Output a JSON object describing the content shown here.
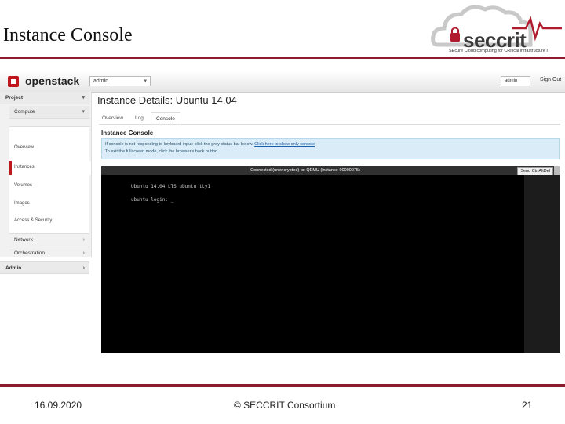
{
  "slide": {
    "title": "Instance Console",
    "footer_date": "16.09.2020",
    "footer_center": "© SECCRIT Consortium",
    "page_number": "21"
  },
  "logo": {
    "brand": "seccrit",
    "tagline": "SEcure Cloud computing for CRitical infrastructure IT",
    "colors": {
      "cloud": "#c9c9c9",
      "accent": "#b01c2e",
      "text": "#3a3a3a"
    }
  },
  "screenshot": {
    "app_name": "openstack",
    "project_select": "admin",
    "user_menu": "admin",
    "sign_out": "Sign Out",
    "sidebar": {
      "project": "Project",
      "compute": "Compute",
      "overview": "Overview",
      "instances": "Instances",
      "volumes": "Volumes",
      "images": "Images",
      "access_security": "Access & Security",
      "network": "Network",
      "orchestration": "Orchestration",
      "admin": "Admin"
    },
    "page_heading": "Instance Details: Ubuntu 14.04",
    "tabs": [
      "Overview",
      "Log",
      "Console"
    ],
    "active_tab": "Console",
    "console_heading": "Instance Console",
    "info_text": "If console is not responding to keyboard input: click the grey status bar below.",
    "info_link": "Click here to show only console",
    "info_text2": "To exit the fullscreen mode, click the browser's back button.",
    "console_status": "Connected (unencrypted) to: QEMU (instance-00000075)",
    "cad_button": "Send CtrlAltDel",
    "terminal_lines": [
      "Ubuntu 14.04 LTS ubuntu tty1",
      "ubuntu login: _"
    ],
    "colors": {
      "brand_red": "#c0171e",
      "info_bg": "#d9ecf7",
      "terminal_bg": "#000000"
    }
  }
}
